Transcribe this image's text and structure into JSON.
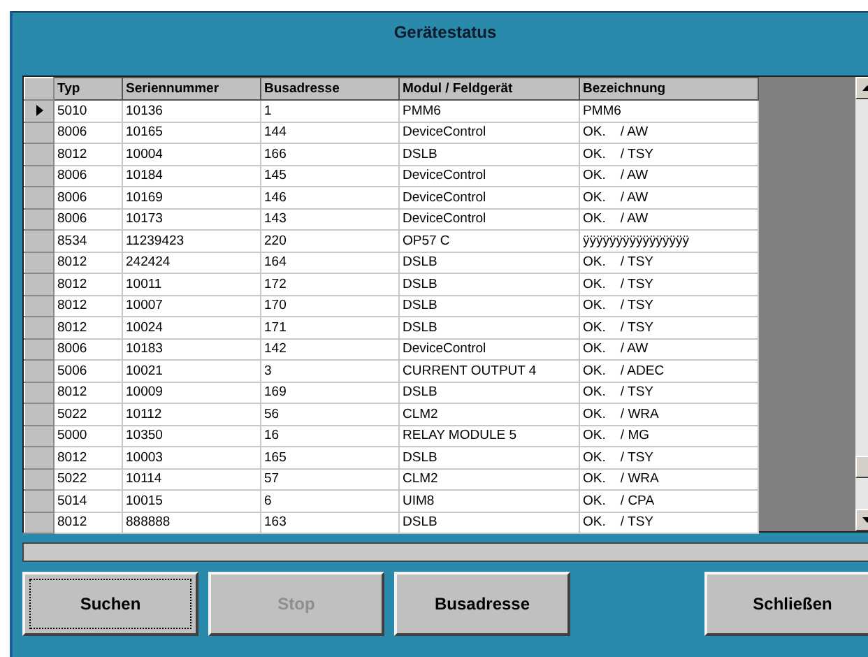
{
  "window": {
    "title": "Gerätestatus"
  },
  "table": {
    "columns": [
      "Typ",
      "Seriennummer",
      "Busadresse",
      "Modul / Feldgerät",
      "Bezeichnung"
    ],
    "rows": [
      {
        "selected": true,
        "cells": [
          "5010",
          "10136",
          "1",
          "PMM6",
          "PMM6"
        ]
      },
      {
        "selected": false,
        "cells": [
          "8006",
          "10165",
          "144",
          "DeviceControl",
          "OK.    / AW"
        ]
      },
      {
        "selected": false,
        "cells": [
          "8012",
          "10004",
          "166",
          "DSLB",
          "OK.    / TSY"
        ]
      },
      {
        "selected": false,
        "cells": [
          "8006",
          "10184",
          "145",
          "DeviceControl",
          "OK.    / AW"
        ]
      },
      {
        "selected": false,
        "cells": [
          "8006",
          "10169",
          "146",
          "DeviceControl",
          "OK.    / AW"
        ]
      },
      {
        "selected": false,
        "cells": [
          "8006",
          "10173",
          "143",
          "DeviceControl",
          "OK.    / AW"
        ]
      },
      {
        "selected": false,
        "cells": [
          "8534",
          "11239423",
          "220",
          "OP57 C",
          "ÿÿÿÿÿÿÿÿÿÿÿÿÿÿÿÿ"
        ]
      },
      {
        "selected": false,
        "cells": [
          "8012",
          "242424",
          "164",
          "DSLB",
          "OK.    / TSY"
        ]
      },
      {
        "selected": false,
        "cells": [
          "8012",
          "10011",
          "172",
          "DSLB",
          "OK.    / TSY"
        ]
      },
      {
        "selected": false,
        "cells": [
          "8012",
          "10007",
          "170",
          "DSLB",
          "OK.    / TSY"
        ]
      },
      {
        "selected": false,
        "cells": [
          "8012",
          "10024",
          "171",
          "DSLB",
          "OK.    / TSY"
        ]
      },
      {
        "selected": false,
        "cells": [
          "8006",
          "10183",
          "142",
          "DeviceControl",
          "OK.    / AW"
        ]
      },
      {
        "selected": false,
        "cells": [
          "5006",
          "10021",
          "3",
          "CURRENT OUTPUT 4",
          "OK.    / ADEC"
        ]
      },
      {
        "selected": false,
        "cells": [
          "8012",
          "10009",
          "169",
          "DSLB",
          "OK.    / TSY"
        ]
      },
      {
        "selected": false,
        "cells": [
          "5022",
          "10112",
          "56",
          "CLM2",
          "OK.    / WRA"
        ]
      },
      {
        "selected": false,
        "cells": [
          "5000",
          "10350",
          "16",
          "RELAY MODULE 5",
          "OK.    / MG"
        ]
      },
      {
        "selected": false,
        "cells": [
          "8012",
          "10003",
          "165",
          "DSLB",
          "OK.    / TSY"
        ]
      },
      {
        "selected": false,
        "cells": [
          "5022",
          "10114",
          "57",
          "CLM2",
          "OK.    / WRA"
        ]
      },
      {
        "selected": false,
        "cells": [
          "5014",
          "10015",
          "6",
          "UIM8",
          "OK.    / CPA"
        ]
      },
      {
        "selected": false,
        "cells": [
          "8012",
          "888888",
          "163",
          "DSLB",
          "OK.    / TSY"
        ]
      }
    ]
  },
  "progress": {
    "level": 0
  },
  "buttons": [
    {
      "label": "Suchen",
      "disabled": false,
      "focused": true
    },
    {
      "label": "Stop",
      "disabled": true,
      "focused": false
    },
    {
      "label": "Busadresse",
      "disabled": false,
      "focused": false
    },
    {
      "label": "Schließen",
      "disabled": false,
      "focused": false
    }
  ]
}
